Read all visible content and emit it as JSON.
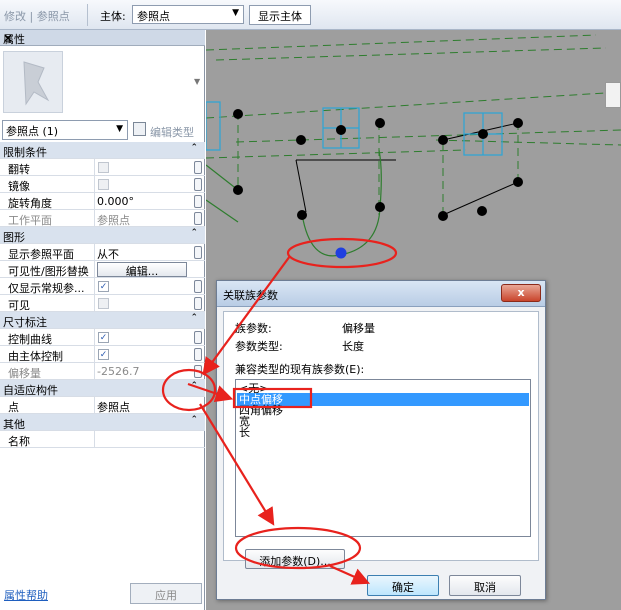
{
  "toolbar": {
    "modify_label": "修改 | 参照点",
    "host_label": "主体:",
    "host_value": "参照点",
    "show_host_button": "显示主体"
  },
  "properties": {
    "title": "属性",
    "close": "×",
    "type_value": "参照点 (1)",
    "edit_type": "编辑类型",
    "groups": [
      {
        "label": "限制条件",
        "rows": [
          {
            "name": "翻转",
            "kind": "checkbox",
            "checked": false
          },
          {
            "name": "镜像",
            "kind": "checkbox",
            "checked": false
          },
          {
            "name": "旋转角度",
            "kind": "text",
            "value": "0.000°"
          },
          {
            "name": "工作平面",
            "kind": "text",
            "value": "参照点",
            "dim": true
          }
        ]
      },
      {
        "label": "图形",
        "rows": [
          {
            "name": "显示参照平面",
            "kind": "text",
            "value": "从不"
          },
          {
            "name": "可见性/图形替换",
            "kind": "button",
            "value": "编辑..."
          },
          {
            "name": "仅显示常规参...",
            "kind": "checkbox",
            "checked": true
          },
          {
            "name": "可见",
            "kind": "checkbox",
            "checked": false
          }
        ]
      },
      {
        "label": "尺寸标注",
        "rows": [
          {
            "name": "控制曲线",
            "kind": "checkbox",
            "checked": true
          },
          {
            "name": "由主体控制",
            "kind": "checkbox",
            "checked": true
          },
          {
            "name": "偏移量",
            "kind": "text",
            "value": "-2526.7",
            "dim": true
          }
        ]
      },
      {
        "label": "自适应构件",
        "rows": [
          {
            "name": "点",
            "kind": "text",
            "value": "参照点"
          }
        ]
      },
      {
        "label": "其他",
        "rows": [
          {
            "name": "名称",
            "kind": "text",
            "value": ""
          }
        ]
      }
    ],
    "help_link": "属性帮助",
    "apply_button": "应用"
  },
  "dialog": {
    "title": "关联族参数",
    "close": "x",
    "family_param_label": "族参数:",
    "family_param_value": "偏移量",
    "param_type_label": "参数类型:",
    "param_type_value": "长度",
    "compatible_label": "兼容类型的现有族参数(E):",
    "list_items": [
      "<无>",
      "中点偏移",
      "四角偏移",
      "宽",
      "长"
    ],
    "selected_index": 1,
    "add_param_button": "添加参数(D)...",
    "ok_button": "确定",
    "cancel_button": "取消"
  },
  "colors": {
    "annotation_red": "#e8221d",
    "view_background": "#9e9e9e",
    "selection_blue": "#3399ff",
    "reference_green": "#2e7d2e",
    "box_cyan": "#2aa6d8"
  }
}
